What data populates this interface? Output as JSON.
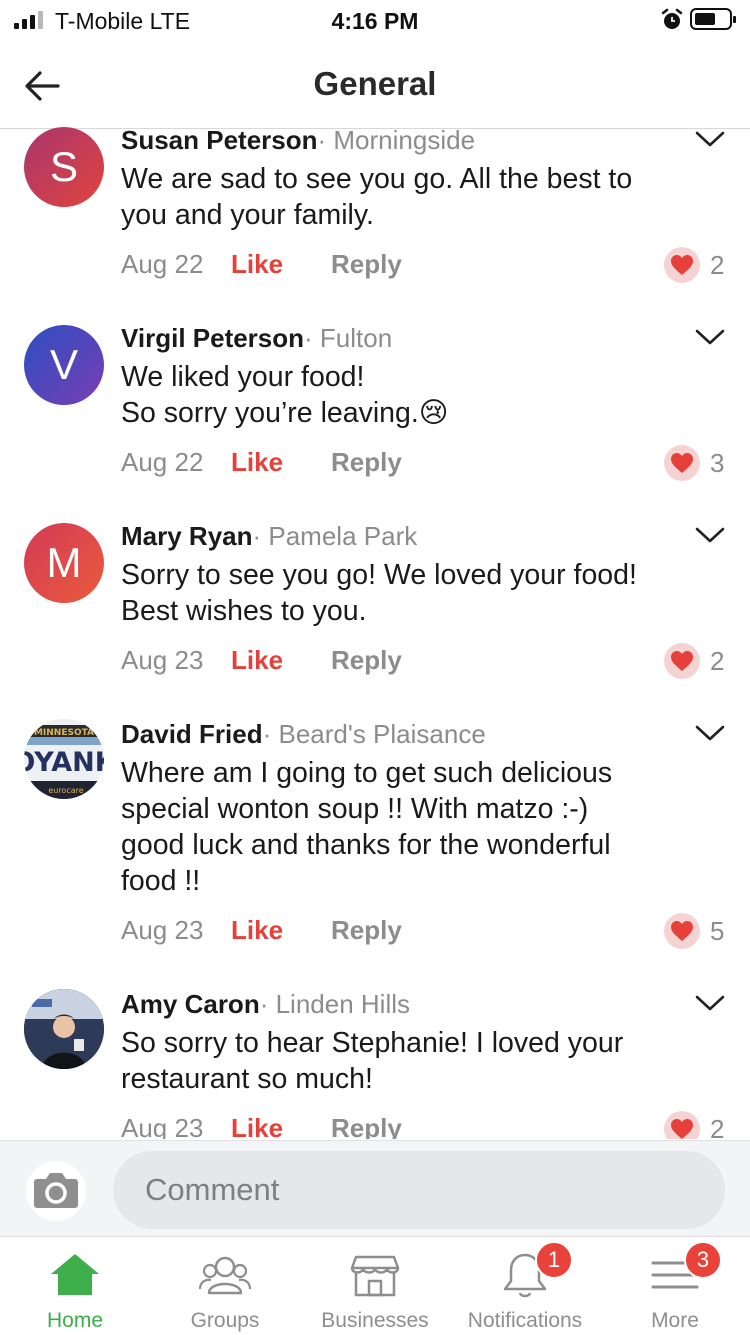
{
  "status_bar": {
    "carrier": "T-Mobile  LTE",
    "time": "4:16 PM"
  },
  "header": {
    "title": "General"
  },
  "comments": [
    {
      "initial": "S",
      "avatar_colors": [
        "#a9366f",
        "#e0443c"
      ],
      "name": "Susan Peterson",
      "neighborhood": "· Morningside",
      "lines": [
        "We are sad to see you go. All the best to",
        "you and your family."
      ],
      "date": "Aug 22",
      "like": "Like",
      "reply": "Reply",
      "reactions": "2"
    },
    {
      "initial": "V",
      "avatar_colors": [
        "#2b4fc0",
        "#7a3db5"
      ],
      "name": "Virgil Peterson",
      "neighborhood": "· Fulton",
      "lines": [
        "We liked your food!",
        "So sorry you’re leaving.😢"
      ],
      "date": "Aug 22",
      "like": "Like",
      "reply": "Reply",
      "reactions": "3"
    },
    {
      "initial": "M",
      "avatar_colors": [
        "#d33a56",
        "#ea5a3c"
      ],
      "name": "Mary Ryan",
      "neighborhood": "· Pamela Park",
      "lines": [
        "Sorry to see you go! We loved your food!",
        "Best wishes to you."
      ],
      "date": "Aug 23",
      "like": "Like",
      "reply": "Reply",
      "reactions": "2"
    },
    {
      "initial": "",
      "avatar_colors": [],
      "name": "David Fried",
      "neighborhood": "· Beard's Plaisance",
      "lines": [
        "Where am I going to get such delicious",
        "special wonton soup !! With matzo :-)",
        "good luck and thanks for the wonderful",
        "food !!"
      ],
      "date": "Aug 23",
      "like": "Like",
      "reply": "Reply",
      "reactions": "5"
    },
    {
      "initial": "",
      "avatar_colors": [],
      "name": "Amy Caron",
      "neighborhood": "· Linden Hills",
      "lines": [
        "So sorry to hear Stephanie! I loved your",
        "restaurant so much!"
      ],
      "date": "Aug 23",
      "like": "Like",
      "reply": "Reply",
      "reactions": "2"
    }
  ],
  "license_plate": {
    "top": "MINNESOTA",
    "main": "OYANK",
    "bottom": "eurocare"
  },
  "comment_bar": {
    "placeholder": "Comment"
  },
  "tabs": [
    {
      "label": "Home",
      "icon": "home-icon",
      "active": true
    },
    {
      "label": "Groups",
      "icon": "groups-icon"
    },
    {
      "label": "Businesses",
      "icon": "store-icon"
    },
    {
      "label": "Notifications",
      "icon": "bell-icon",
      "badge": "1"
    },
    {
      "label": "More",
      "icon": "menu-icon",
      "badge": "3"
    }
  ],
  "colors": {
    "accent": "#3dae4a",
    "like": "#e5403a",
    "badge": "#e8423a",
    "muted": "#8c8c8c"
  }
}
